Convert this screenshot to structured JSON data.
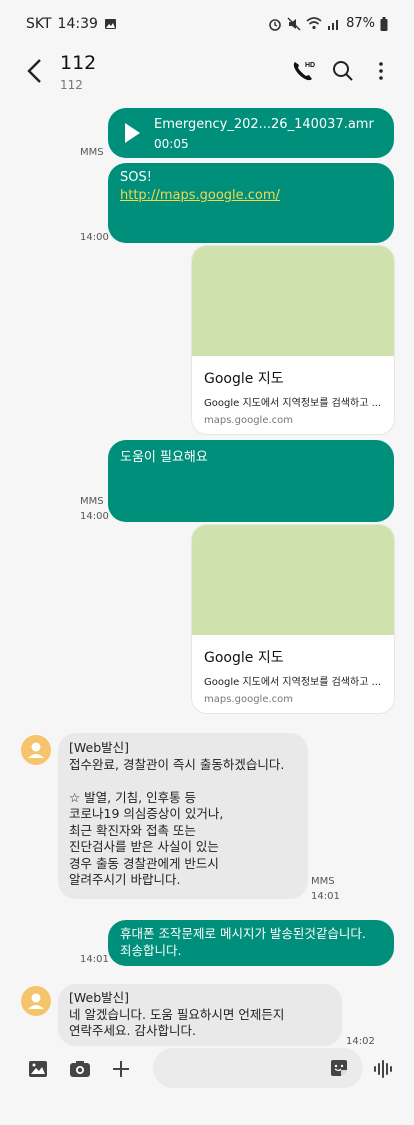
{
  "status_bar": {
    "carrier": "SKT",
    "time": "14:39",
    "battery": "87%",
    "icons": [
      "image-icon",
      "alarm-icon",
      "mute-icon",
      "wifi-icon",
      "signal-icon",
      "battery-icon"
    ]
  },
  "header": {
    "title": "112",
    "subtitle": "112"
  },
  "messages": {
    "audio": {
      "filename": "Emergency_202...26_140037.amr",
      "duration": "00:05",
      "label": "MMS"
    },
    "sos": {
      "line1": "SOS!",
      "link": "http://maps.google.com/",
      "time": "14:00"
    },
    "card1": {
      "title": "Google 지도",
      "desc": "Google 지도에서 지역정보를 검색하고 ...",
      "url": "maps.google.com"
    },
    "help": {
      "text": "도움이 필요해요",
      "label": "MMS",
      "time": "14:00"
    },
    "card2": {
      "title": "Google 지도",
      "desc": "Google 지도에서 지역정보를 검색하고 ...",
      "url": "maps.google.com"
    },
    "incoming1": {
      "text": "[Web발신]\n접수완료, 경찰관이 즉시 출동하겠습니다.\n\n☆ 발열, 기침, 인후통 등\n코로나19 의심증상이 있거나,\n최근 확진자와 접촉 또는\n진단검사를 받은 사실이 있는\n경우 출동 경찰관에게 반드시\n알려주시기 바랍니다.",
      "label": "MMS",
      "time": "14:01"
    },
    "outgoing2": {
      "text": "휴대폰 조작문제로 메시지가 발송된것같습니다.\n죄송합니다.",
      "time": "14:01"
    },
    "incoming2": {
      "text": "[Web발신]\n네 알겠습니다. 도움 필요하시면 언제든지\n연락주세요. 감사합니다.",
      "time": "14:02"
    }
  },
  "bottom_bar": {
    "icons": [
      "gallery-icon",
      "camera-icon",
      "plus-icon",
      "sticker-icon",
      "voice-icon"
    ]
  },
  "colors": {
    "accent": "#008f7a",
    "incoming": "#e9e9e9",
    "map_placeholder": "#cfe1ad",
    "avatar": "#f6c46a"
  }
}
